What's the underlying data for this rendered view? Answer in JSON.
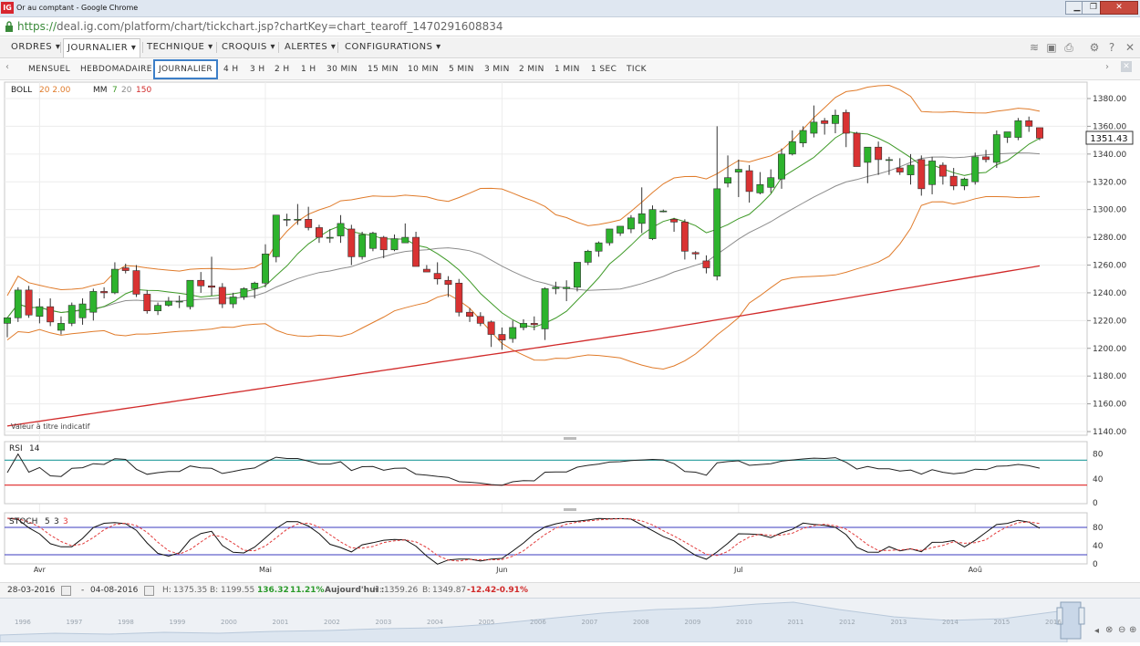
{
  "window": {
    "title": "Or au comptant - Google Chrome",
    "logo": "IG",
    "controls": [
      "minimize-icon",
      "maximize-icon",
      "close-icon"
    ]
  },
  "browser": {
    "url_scheme": "https://",
    "url_rest": "deal.ig.com/platform/chart/tickchart.jsp?chartKey=chart_tearoff_1470291608834"
  },
  "menu": [
    {
      "label": "ORDRES"
    },
    {
      "label": "JOURNALIER"
    },
    {
      "label": "TECHNIQUE"
    },
    {
      "label": "CROQUIS"
    },
    {
      "label": "ALERTES"
    },
    {
      "label": "CONFIGURATIONS"
    }
  ],
  "toolbar_icons": [
    "layers-icon",
    "image-icon",
    "print-icon",
    "gear-icon",
    "help-icon",
    "close-icon"
  ],
  "timeframes": [
    "MENSUEL",
    "HEBDOMADAIRE",
    "JOURNALIER",
    "4 H",
    "3 H",
    "2 H",
    "1 H",
    "30 MIN",
    "15 MIN",
    "10 MIN",
    "5 MIN",
    "3 MIN",
    "2 MIN",
    "1 MIN",
    "1 SEC",
    "TICK"
  ],
  "active_timeframe": "JOURNALIER",
  "indicators": {
    "boll_name": "BOLL",
    "boll_params": "20 2.00",
    "mm_name": "MM",
    "mm_p1": "7",
    "mm_p2": "20",
    "mm_p3": "150",
    "rsi_name": "RSI",
    "rsi_params": "14",
    "stoch_name": "STOCH",
    "stoch_p1": "5",
    "stoch_p2": "3",
    "stoch_p3": "3"
  },
  "indicative_note": "Valeur à titre indicatif",
  "current_price": "1351.43",
  "colors": {
    "bull": "#2db32d",
    "bear": "#d93232",
    "boll": "#e07b2a",
    "mm7": "#3f9a28",
    "mm20": "#8c8c8c",
    "mm150": "#d12a2a",
    "rsi_line": "#222222",
    "rsi_upper": "#3aa6a6",
    "rsi_lower": "#e23b3b",
    "stoch_k": "#111111",
    "stoch_d": "#e23b3b",
    "stoch_band": "#3b3bbf"
  },
  "status": {
    "start_date": "28-03-2016",
    "end_date": "04-08-2016",
    "high_label": "H:",
    "high": "1375.35",
    "low_label": "B:",
    "low": "1199.55",
    "change": "136.32",
    "change_pct": "11.21%",
    "today_label": "Aujourd'hui :",
    "today_high": "1359.26",
    "today_low": "1349.87",
    "today_change": "-12.42",
    "today_change_pct": "-0.91%"
  },
  "navigator_years": [
    "1996",
    "1997",
    "1998",
    "1999",
    "2000",
    "2001",
    "2002",
    "2003",
    "2004",
    "2005",
    "2006",
    "2007",
    "2008",
    "2009",
    "2010",
    "2011",
    "2012",
    "2013",
    "2014",
    "2015",
    "2016"
  ],
  "chart_data": {
    "type": "candlestick",
    "price_axis": {
      "min": 1140,
      "max": 1380,
      "ticks": [
        "1140.00",
        "1160.00",
        "1180.00",
        "1200.00",
        "1220.00",
        "1240.00",
        "1260.00",
        "1280.00",
        "1300.00",
        "1320.00",
        "1340.00",
        "1360.00",
        "1380.00"
      ]
    },
    "x_labels": [
      "Avr",
      "Mai",
      "Jun",
      "Jul",
      "Aoû"
    ],
    "x_label_index": [
      3,
      24,
      46,
      68,
      90
    ],
    "candles": [
      {
        "o": 1218,
        "h": 1222,
        "l": 1208,
        "c": 1222
      },
      {
        "o": 1222,
        "h": 1244,
        "l": 1219,
        "c": 1242
      },
      {
        "o": 1242,
        "h": 1245,
        "l": 1222,
        "c": 1224
      },
      {
        "o": 1223,
        "h": 1236,
        "l": 1218,
        "c": 1230
      },
      {
        "o": 1230,
        "h": 1236,
        "l": 1216,
        "c": 1219
      },
      {
        "o": 1213,
        "h": 1223,
        "l": 1210,
        "c": 1218
      },
      {
        "o": 1218,
        "h": 1233,
        "l": 1216,
        "c": 1231
      },
      {
        "o": 1222,
        "h": 1236,
        "l": 1217,
        "c": 1232
      },
      {
        "o": 1226,
        "h": 1243,
        "l": 1220,
        "c": 1241
      },
      {
        "o": 1241,
        "h": 1244,
        "l": 1236,
        "c": 1240
      },
      {
        "o": 1240,
        "h": 1262,
        "l": 1239,
        "c": 1257
      },
      {
        "o": 1258,
        "h": 1261,
        "l": 1254,
        "c": 1256
      },
      {
        "o": 1256,
        "h": 1260,
        "l": 1237,
        "c": 1239
      },
      {
        "o": 1239,
        "h": 1242,
        "l": 1225,
        "c": 1227
      },
      {
        "o": 1227,
        "h": 1233,
        "l": 1224,
        "c": 1231
      },
      {
        "o": 1231,
        "h": 1237,
        "l": 1230,
        "c": 1234
      },
      {
        "o": 1234,
        "h": 1238,
        "l": 1229,
        "c": 1234
      },
      {
        "o": 1230,
        "h": 1248,
        "l": 1228,
        "c": 1249
      },
      {
        "o": 1249,
        "h": 1255,
        "l": 1240,
        "c": 1245
      },
      {
        "o": 1245,
        "h": 1266,
        "l": 1238,
        "c": 1244
      },
      {
        "o": 1244,
        "h": 1247,
        "l": 1229,
        "c": 1232
      },
      {
        "o": 1232,
        "h": 1240,
        "l": 1229,
        "c": 1237
      },
      {
        "o": 1237,
        "h": 1244,
        "l": 1235,
        "c": 1243
      },
      {
        "o": 1243,
        "h": 1248,
        "l": 1236,
        "c": 1247
      },
      {
        "o": 1247,
        "h": 1275,
        "l": 1244,
        "c": 1268
      },
      {
        "o": 1266,
        "h": 1296,
        "l": 1262,
        "c": 1296
      },
      {
        "o": 1293,
        "h": 1297,
        "l": 1288,
        "c": 1293
      },
      {
        "o": 1293,
        "h": 1304,
        "l": 1289,
        "c": 1293
      },
      {
        "o": 1293,
        "h": 1302,
        "l": 1285,
        "c": 1287
      },
      {
        "o": 1287,
        "h": 1289,
        "l": 1276,
        "c": 1280
      },
      {
        "o": 1280,
        "h": 1286,
        "l": 1276,
        "c": 1280
      },
      {
        "o": 1281,
        "h": 1296,
        "l": 1276,
        "c": 1290
      },
      {
        "o": 1286,
        "h": 1289,
        "l": 1260,
        "c": 1266
      },
      {
        "o": 1266,
        "h": 1284,
        "l": 1264,
        "c": 1282
      },
      {
        "o": 1272,
        "h": 1284,
        "l": 1270,
        "c": 1283
      },
      {
        "o": 1280,
        "h": 1281,
        "l": 1265,
        "c": 1271
      },
      {
        "o": 1271,
        "h": 1282,
        "l": 1270,
        "c": 1279
      },
      {
        "o": 1276,
        "h": 1290,
        "l": 1276,
        "c": 1280
      },
      {
        "o": 1280,
        "h": 1284,
        "l": 1262,
        "c": 1259
      },
      {
        "o": 1257,
        "h": 1260,
        "l": 1255,
        "c": 1255
      },
      {
        "o": 1254,
        "h": 1262,
        "l": 1246,
        "c": 1250
      },
      {
        "o": 1249,
        "h": 1252,
        "l": 1237,
        "c": 1246
      },
      {
        "o": 1247,
        "h": 1250,
        "l": 1223,
        "c": 1226
      },
      {
        "o": 1226,
        "h": 1229,
        "l": 1219,
        "c": 1223
      },
      {
        "o": 1223,
        "h": 1226,
        "l": 1216,
        "c": 1218
      },
      {
        "o": 1219,
        "h": 1220,
        "l": 1201,
        "c": 1210
      },
      {
        "o": 1210,
        "h": 1215,
        "l": 1199,
        "c": 1206
      },
      {
        "o": 1207,
        "h": 1220,
        "l": 1204,
        "c": 1215
      },
      {
        "o": 1215,
        "h": 1221,
        "l": 1213,
        "c": 1218
      },
      {
        "o": 1218,
        "h": 1223,
        "l": 1213,
        "c": 1217
      },
      {
        "o": 1214,
        "h": 1244,
        "l": 1206,
        "c": 1243
      },
      {
        "o": 1243,
        "h": 1248,
        "l": 1239,
        "c": 1244
      },
      {
        "o": 1243,
        "h": 1249,
        "l": 1234,
        "c": 1244
      },
      {
        "o": 1244,
        "h": 1261,
        "l": 1241,
        "c": 1262
      },
      {
        "o": 1262,
        "h": 1271,
        "l": 1260,
        "c": 1270
      },
      {
        "o": 1270,
        "h": 1277,
        "l": 1266,
        "c": 1276
      },
      {
        "o": 1276,
        "h": 1286,
        "l": 1274,
        "c": 1286
      },
      {
        "o": 1283,
        "h": 1288,
        "l": 1281,
        "c": 1288
      },
      {
        "o": 1286,
        "h": 1296,
        "l": 1283,
        "c": 1294
      },
      {
        "o": 1290,
        "h": 1316,
        "l": 1283,
        "c": 1297
      },
      {
        "o": 1279,
        "h": 1303,
        "l": 1278,
        "c": 1300
      },
      {
        "o": 1299,
        "h": 1300,
        "l": 1298,
        "c": 1299
      },
      {
        "o": 1293,
        "h": 1294,
        "l": 1284,
        "c": 1291
      },
      {
        "o": 1291,
        "h": 1293,
        "l": 1264,
        "c": 1270
      },
      {
        "o": 1269,
        "h": 1270,
        "l": 1264,
        "c": 1268
      },
      {
        "o": 1263,
        "h": 1267,
        "l": 1254,
        "c": 1258
      },
      {
        "o": 1252,
        "h": 1360,
        "l": 1249,
        "c": 1315
      },
      {
        "o": 1319,
        "h": 1339,
        "l": 1316,
        "c": 1323
      },
      {
        "o": 1327,
        "h": 1336,
        "l": 1309,
        "c": 1329
      },
      {
        "o": 1328,
        "h": 1332,
        "l": 1305,
        "c": 1313
      },
      {
        "o": 1312,
        "h": 1327,
        "l": 1311,
        "c": 1318
      },
      {
        "o": 1316,
        "h": 1329,
        "l": 1312,
        "c": 1323
      },
      {
        "o": 1322,
        "h": 1344,
        "l": 1315,
        "c": 1340
      },
      {
        "o": 1340,
        "h": 1357,
        "l": 1339,
        "c": 1349
      },
      {
        "o": 1348,
        "h": 1360,
        "l": 1345,
        "c": 1357
      },
      {
        "o": 1355,
        "h": 1375,
        "l": 1352,
        "c": 1363
      },
      {
        "o": 1364,
        "h": 1366,
        "l": 1354,
        "c": 1362
      },
      {
        "o": 1362,
        "h": 1372,
        "l": 1355,
        "c": 1368
      },
      {
        "o": 1370,
        "h": 1372,
        "l": 1345,
        "c": 1355
      },
      {
        "o": 1355,
        "h": 1356,
        "l": 1333,
        "c": 1331
      },
      {
        "o": 1334,
        "h": 1338,
        "l": 1319,
        "c": 1345
      },
      {
        "o": 1345,
        "h": 1349,
        "l": 1325,
        "c": 1336
      },
      {
        "o": 1336,
        "h": 1338,
        "l": 1325,
        "c": 1336
      },
      {
        "o": 1330,
        "h": 1337,
        "l": 1325,
        "c": 1327
      },
      {
        "o": 1325,
        "h": 1340,
        "l": 1318,
        "c": 1332
      },
      {
        "o": 1336,
        "h": 1339,
        "l": 1310,
        "c": 1315
      },
      {
        "o": 1318,
        "h": 1338,
        "l": 1311,
        "c": 1335
      },
      {
        "o": 1332,
        "h": 1334,
        "l": 1318,
        "c": 1324
      },
      {
        "o": 1324,
        "h": 1330,
        "l": 1314,
        "c": 1317
      },
      {
        "o": 1317,
        "h": 1323,
        "l": 1314,
        "c": 1322
      },
      {
        "o": 1320,
        "h": 1341,
        "l": 1318,
        "c": 1338
      },
      {
        "o": 1338,
        "h": 1343,
        "l": 1334,
        "c": 1336
      },
      {
        "o": 1334,
        "h": 1357,
        "l": 1330,
        "c": 1354
      },
      {
        "o": 1352,
        "h": 1356,
        "l": 1348,
        "c": 1356
      },
      {
        "o": 1352,
        "h": 1366,
        "l": 1350,
        "c": 1364
      },
      {
        "o": 1364,
        "h": 1367,
        "l": 1356,
        "c": 1360
      },
      {
        "o": 1359,
        "h": 1359,
        "l": 1350,
        "c": 1351.43
      }
    ]
  }
}
